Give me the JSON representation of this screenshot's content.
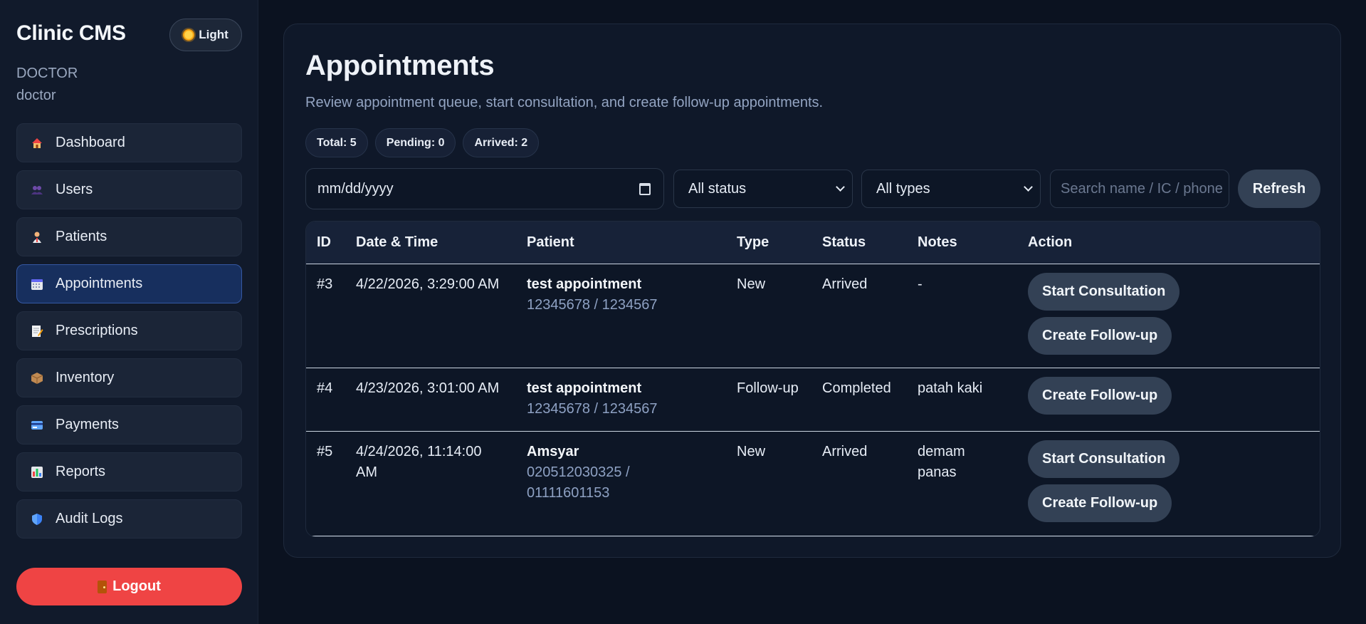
{
  "sidebar": {
    "brand": "Clinic CMS",
    "theme_label": "Light",
    "role": "DOCTOR",
    "username": "doctor",
    "items": [
      {
        "label": "Dashboard",
        "icon": "house-icon"
      },
      {
        "label": "Users",
        "icon": "users-icon"
      },
      {
        "label": "Patients",
        "icon": "patient-icon"
      },
      {
        "label": "Appointments",
        "icon": "calendar-icon",
        "active": true
      },
      {
        "label": "Prescriptions",
        "icon": "memo-icon"
      },
      {
        "label": "Inventory",
        "icon": "package-icon"
      },
      {
        "label": "Payments",
        "icon": "card-icon"
      },
      {
        "label": "Reports",
        "icon": "bar-chart-icon"
      },
      {
        "label": "Audit Logs",
        "icon": "shield-icon"
      }
    ],
    "logout_label": "Logout"
  },
  "main": {
    "title": "Appointments",
    "subtitle": "Review appointment queue, start consultation, and create follow-up appointments.",
    "badges": [
      "Total: 5",
      "Pending: 0",
      "Arrived: 2"
    ],
    "filters": {
      "date_placeholder": "mm/dd/yyyy",
      "status_selected": "All status",
      "type_selected": "All types",
      "search_placeholder": "Search name / IC / phone",
      "refresh_label": "Refresh"
    },
    "table": {
      "headers": [
        "ID",
        "Date & Time",
        "Patient",
        "Type",
        "Status",
        "Notes",
        "Action"
      ],
      "rows": [
        {
          "id": "#3",
          "datetime": "4/22/2026, 3:29:00 AM",
          "patient_name": "test appointment",
          "patient_ids": "12345678 / 1234567",
          "type": "New",
          "status": "Arrived",
          "notes": "-",
          "actions": [
            "Start Consultation",
            "Create Follow-up"
          ]
        },
        {
          "id": "#4",
          "datetime": "4/23/2026, 3:01:00 AM",
          "patient_name": "test appointment",
          "patient_ids": "12345678 / 1234567",
          "type": "Follow-up",
          "status": "Completed",
          "notes": "patah kaki",
          "actions": [
            "Create Follow-up"
          ]
        },
        {
          "id": "#5",
          "datetime": "4/24/2026, 11:14:00 AM",
          "patient_name": "Amsyar",
          "patient_ids": "020512030325 / 01111601153",
          "type": "New",
          "status": "Arrived",
          "notes": "demam panas",
          "actions": [
            "Start Consultation",
            "Create Follow-up"
          ]
        }
      ]
    }
  },
  "colors": {
    "background": "#0b1220",
    "sidebar": "#111a2b",
    "active_nav": "#172f5e",
    "logout": "#ef4444",
    "button": "#334155",
    "muted_text": "#8ea1c3"
  }
}
